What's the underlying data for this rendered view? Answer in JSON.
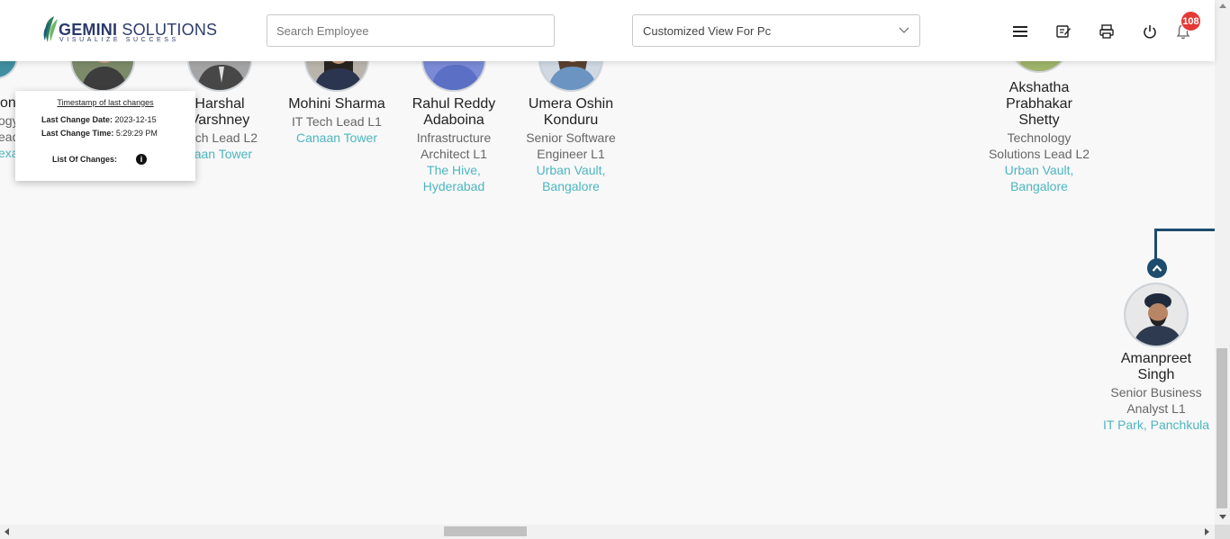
{
  "header": {
    "logo_title_bold": "GEMINI",
    "logo_title_rest": " SOLUTIONS",
    "logo_tagline": "VISUALIZE SUCCESS",
    "search_placeholder": "Search Employee",
    "view_selected": "Customized View For Pc",
    "notification_count": "108"
  },
  "popup": {
    "title": "Timestamp of last changes",
    "date_label": "Last Change Date:",
    "date_value": "2023-12-15",
    "time_label": "Last Change Time:",
    "time_value": "5:29:29 PM",
    "changes_label": "List Of Changes:"
  },
  "partial_card": {
    "name": "ond",
    "role_1": "ogy",
    "role_2": "ead",
    "location": "exa"
  },
  "employees": [
    {
      "name_1": "Harshal",
      "name_2": "Varshney",
      "role_1": "Tech Lead L2",
      "location_1": "naan Tower"
    },
    {
      "name_1": "Mohini Sharma",
      "role_1": "IT Tech Lead L1",
      "location_1": "Canaan Tower"
    },
    {
      "name_1": "Rahul Reddy",
      "name_2": "Adaboina",
      "role_1": "Infrastructure",
      "role_2": "Architect L1",
      "location_1": "The Hive,",
      "location_2": "Hyderabad"
    },
    {
      "name_1": "Umera Oshin",
      "name_2": "Konduru",
      "role_1": "Senior Software",
      "role_2": "Engineer L1",
      "location_1": "Urban Vault,",
      "location_2": "Bangalore"
    },
    {
      "name_1": "Akshatha",
      "name_2": "Prabhakar",
      "name_3": "Shetty",
      "role_1": "Technology",
      "role_2": "Solutions Lead L2",
      "location_1": "Urban Vault,",
      "location_2": "Bangalore"
    },
    {
      "name_1": "Amanpreet",
      "name_2": "Singh",
      "role_1": "Senior Business",
      "role_2": "Analyst L1",
      "location_1": "IT Park, Panchkula"
    }
  ],
  "colors": {
    "accent_teal": "#4db6c0",
    "connector": "#1d4c6e",
    "badge": "#e53935"
  }
}
